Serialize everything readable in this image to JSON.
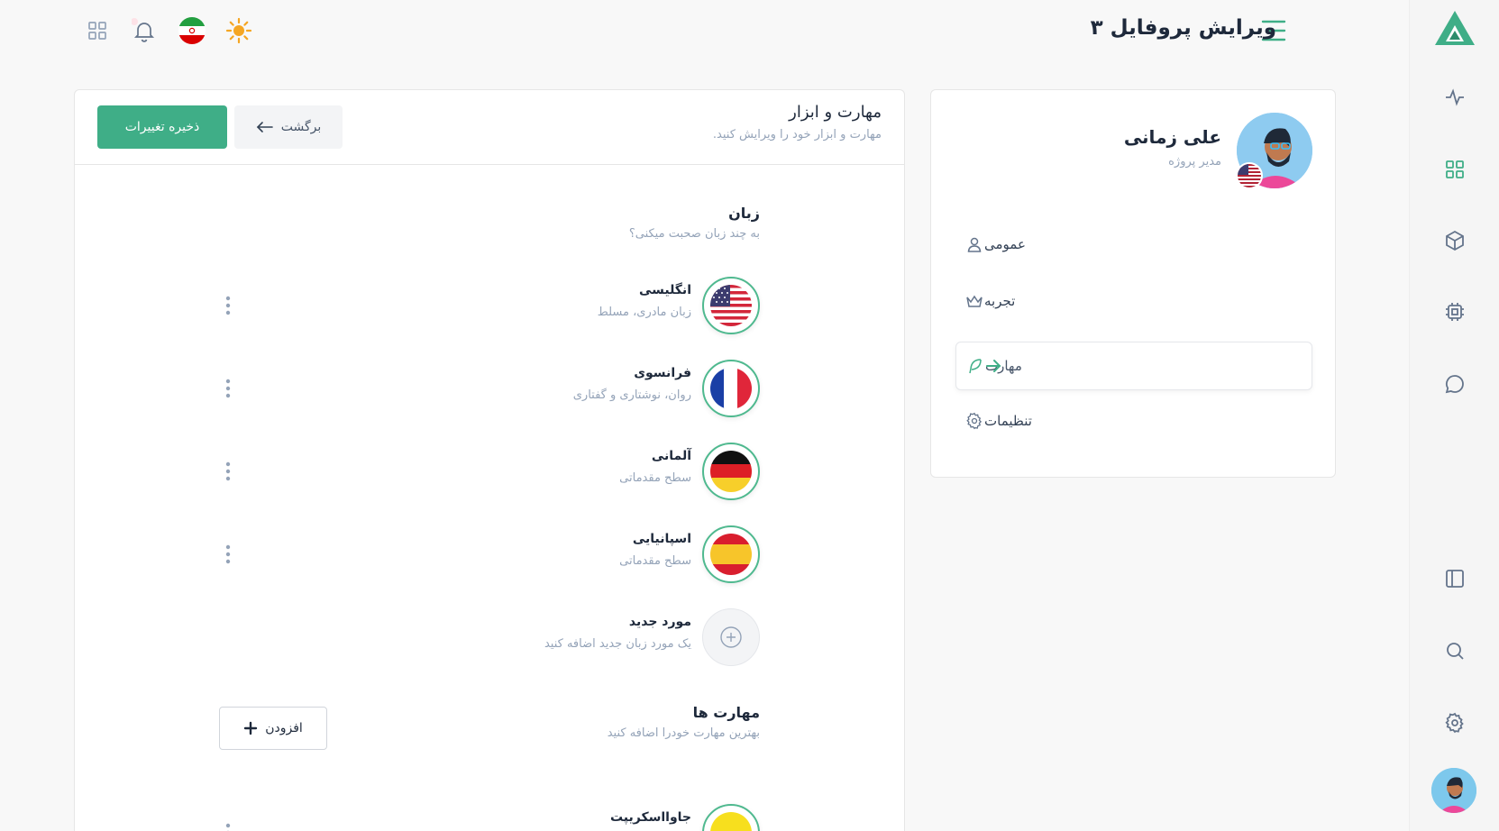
{
  "page": {
    "title": "ویرایش پروفایل ۳"
  },
  "topbar": {
    "icons": [
      "theme-sun-icon",
      "language-flag-iran-icon",
      "notification-bell-icon",
      "apps-grid-icon"
    ]
  },
  "rail": {
    "icons": [
      "logo-icon",
      "activity-icon",
      "dashboard-grid-icon",
      "box-icon",
      "cpu-icon",
      "chat-icon",
      "sidebar-panel-icon",
      "search-icon",
      "settings-gear-icon",
      "user-avatar"
    ]
  },
  "profile": {
    "name": "علی زمانی",
    "role": "مدیر پروژه",
    "nav": [
      {
        "label": "عمومی",
        "icon": "user-icon"
      },
      {
        "label": "تجربه",
        "icon": "crown-icon"
      },
      {
        "label": "مهارت",
        "icon": "feather-icon",
        "active": true
      },
      {
        "label": "تنظیمات",
        "icon": "gear-icon"
      }
    ]
  },
  "main": {
    "title": "مهارت و ابزار",
    "subtitle": "مهارت و ابزار خود را ویرایش کنید.",
    "save_label": "ذخیره تغییرات",
    "back_label": "برگشت",
    "languages": {
      "title": "زبان",
      "subtitle": "به چند زبان صحبت میکنی؟",
      "items": [
        {
          "name": "انگلیسی",
          "desc": "زبان مادری، مسلط",
          "flag": "us"
        },
        {
          "name": "فرانسوی",
          "desc": "روان، نوشتاری و گفتاری",
          "flag": "fr"
        },
        {
          "name": "آلمانی",
          "desc": "سطح مقدماتی",
          "flag": "de"
        },
        {
          "name": "اسپانیایی",
          "desc": "سطح مقدماتی",
          "flag": "es"
        }
      ],
      "new_item": {
        "name": "مورد جدید",
        "desc": "یک مورد زبان جدید اضافه کنید"
      },
      "add_label": "افزودن"
    },
    "skills": {
      "title": "مهارت ها",
      "subtitle": "بهترین مهارت خودرا اضافه کنید",
      "items": [
        {
          "name": "جاوااسکریپت"
        }
      ]
    }
  },
  "colors": {
    "accent": "#3fae87",
    "text": "#1e293b",
    "muted": "#94a3b8"
  }
}
